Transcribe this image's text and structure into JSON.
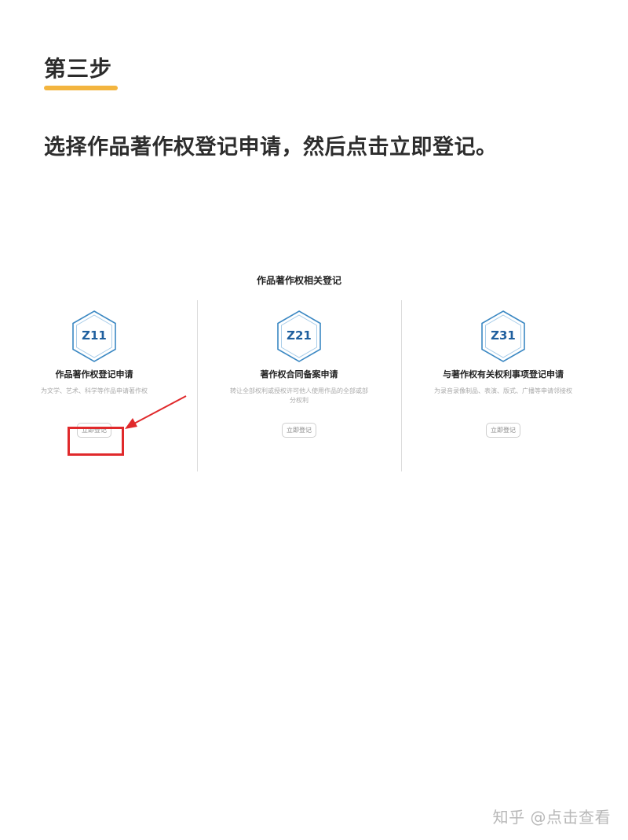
{
  "step": {
    "heading": "第三步",
    "instruction": "选择作品著作权登记申请，然后点击立即登记。",
    "underline_color": "#f3b53f"
  },
  "panel": {
    "title": "作品著作权相关登记",
    "cards": [
      {
        "code": "Z11",
        "title": "作品著作权登记申请",
        "desc": "为文学、艺术、科学等作品申请著作权",
        "button": "立即登记",
        "icon": "hexagon-icon"
      },
      {
        "code": "Z21",
        "title": "著作权合同备案申请",
        "desc": "转让全部权利或授权许可他人使用作品的全部或部分权利",
        "button": "立即登记",
        "icon": "hexagon-icon"
      },
      {
        "code": "Z31",
        "title": "与著作权有关权利事项登记申请",
        "desc": "为录音录像制品、表演、版式、广播等申请邻接权",
        "button": "立即登记",
        "icon": "hexagon-icon"
      }
    ]
  },
  "annotation": {
    "highlight_color": "#e0292b",
    "arrow_icon": "red-arrow-icon"
  },
  "watermark": "知乎 @点击查看"
}
